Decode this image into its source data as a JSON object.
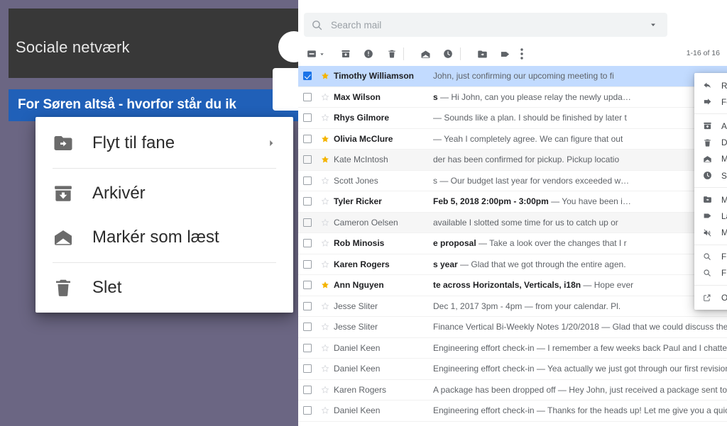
{
  "left_panel": {
    "background_color": "#6b6683",
    "topbar": {
      "background_color": "#383838",
      "title": "Sociale netværk",
      "fab_name": "compose-fab"
    },
    "banner": {
      "background_color": "#2060b8",
      "text": "For Søren altså - hvorfor står du ik"
    },
    "menu": {
      "items": [
        {
          "icon": "move-to-tab-icon",
          "label": "Flyt til fane",
          "has_submenu": true
        },
        {
          "separator": true
        },
        {
          "icon": "archive-icon",
          "label": "Arkivér",
          "has_submenu": false
        },
        {
          "icon": "mark-as-read-icon",
          "label": "Markér som læst",
          "has_submenu": false
        },
        {
          "separator": true
        },
        {
          "icon": "delete-icon",
          "label": "Slet",
          "has_submenu": false
        }
      ]
    }
  },
  "gmail": {
    "search": {
      "placeholder": "Search mail",
      "value": "",
      "search_icon": "search-icon",
      "dropdown_icon": "chevron-down-icon"
    },
    "toolbar": {
      "buttons": [
        {
          "name": "select-all-checkbox",
          "icon": "checkbox-indeterminate-icon"
        },
        {
          "name": "select-all-dropdown",
          "icon": "chevron-down-icon"
        },
        {
          "name": "archive-button",
          "icon": "archive-icon"
        },
        {
          "name": "report-spam-button",
          "icon": "report-spam-icon"
        },
        {
          "name": "delete-button",
          "icon": "trash-icon"
        },
        {
          "name": "mark-as-read-button",
          "icon": "open-envelope-icon"
        },
        {
          "name": "snooze-button",
          "icon": "clock-icon"
        },
        {
          "name": "move-to-button",
          "icon": "move-to-folder-icon"
        },
        {
          "name": "labels-button",
          "icon": "label-icon"
        },
        {
          "name": "more-options-button",
          "icon": "more-vert-icon"
        }
      ],
      "count_text": "1-16 of 16"
    },
    "rows": [
      {
        "selected": true,
        "starred": true,
        "unread": true,
        "read_bg": false,
        "sender": "Timothy Williamson",
        "subject": "",
        "snippet": "John, just confirming our upcoming meeting to fi"
      },
      {
        "selected": false,
        "starred": false,
        "unread": true,
        "read_bg": false,
        "sender": "Max Wilson",
        "subject": "s",
        "snippet": "— Hi John, can you please relay the newly upda…"
      },
      {
        "selected": false,
        "starred": false,
        "unread": true,
        "read_bg": false,
        "sender": "Rhys Gilmore",
        "subject": "",
        "snippet": "— Sounds like a plan. I should be finished by later t"
      },
      {
        "selected": false,
        "starred": true,
        "unread": true,
        "read_bg": false,
        "sender": "Olivia McClure",
        "subject": "",
        "snippet": "— Yeah I completely agree. We can figure that out "
      },
      {
        "selected": false,
        "starred": true,
        "unread": false,
        "read_bg": true,
        "sender": "Kate McIntosh",
        "subject": "",
        "snippet": "der has been confirmed for pickup. Pickup locatio"
      },
      {
        "selected": false,
        "starred": false,
        "unread": false,
        "read_bg": false,
        "sender": "Scott Jones",
        "subject": "s",
        "snippet": "— Our budget last year for vendors exceeded w…"
      },
      {
        "selected": false,
        "starred": false,
        "unread": true,
        "read_bg": false,
        "sender": "Tyler Ricker",
        "subject": "Feb 5, 2018 2:00pm - 3:00pm",
        "snippet": "— You have been i…"
      },
      {
        "selected": false,
        "starred": false,
        "unread": false,
        "read_bg": true,
        "sender": "Cameron Oelsen",
        "subject": "",
        "snippet": "available I slotted some time for us to catch up or"
      },
      {
        "selected": false,
        "starred": false,
        "unread": true,
        "read_bg": false,
        "sender": "Rob Minosis",
        "subject": "e proposal",
        "snippet": "— Take a look over the changes that I r"
      },
      {
        "selected": false,
        "starred": false,
        "unread": true,
        "read_bg": false,
        "sender": "Karen Rogers",
        "subject": "s year",
        "snippet": "— Glad that we got through the entire agen."
      },
      {
        "selected": false,
        "starred": true,
        "unread": true,
        "read_bg": false,
        "sender": "Ann Nguyen",
        "subject": "te across Horizontals, Verticals, i18n",
        "snippet": "— Hope ever"
      },
      {
        "selected": false,
        "starred": false,
        "unread": false,
        "read_bg": false,
        "sender": "Jesse Sliter",
        "subject": "Dec 1, 2017 3pm - 4pm",
        "snippet": "— from your calendar. Pl."
      },
      {
        "selected": false,
        "starred": false,
        "unread": false,
        "read_bg": false,
        "sender": "Jesse Sliter",
        "subject": "Finance Vertical Bi-Weekly Notes 1/20/2018",
        "snippet": "— Glad that we could discuss the bu…"
      },
      {
        "selected": false,
        "starred": false,
        "unread": false,
        "read_bg": false,
        "sender": "Daniel Keen",
        "subject": "Engineering effort check-in",
        "snippet": "— I remember a few weeks back Paul and I chatted abo"
      },
      {
        "selected": false,
        "starred": false,
        "unread": false,
        "read_bg": false,
        "sender": "Daniel Keen",
        "subject": "Engineering effort check-in",
        "snippet": "— Yea actually we just got through our first revision an"
      },
      {
        "selected": false,
        "starred": false,
        "unread": false,
        "read_bg": false,
        "sender": "Karen Rogers",
        "subject": "A package has been dropped off",
        "snippet": "— Hey John, just received a package sent to you."
      },
      {
        "selected": false,
        "starred": false,
        "unread": false,
        "read_bg": false,
        "sender": "Daniel Keen",
        "subject": "Engineering effort check-in",
        "snippet": "— Thanks for the heads up! Let me give you a quick ove"
      }
    ],
    "context_menu": {
      "items": [
        {
          "icon": "reply-icon",
          "label": "Reply",
          "has_submenu": false
        },
        {
          "icon": "forward-icon",
          "label": "Forward",
          "has_submenu": false
        },
        {
          "separator": true
        },
        {
          "icon": "archive-icon",
          "label": "Archive",
          "has_submenu": false
        },
        {
          "icon": "trash-icon",
          "label": "Delete",
          "has_submenu": false
        },
        {
          "icon": "open-envelope-icon",
          "label": "Mark as unread",
          "has_submenu": false
        },
        {
          "icon": "clock-icon",
          "label": "Snooze",
          "has_submenu": false
        },
        {
          "separator": true
        },
        {
          "icon": "move-to-folder-icon",
          "label": "Move to",
          "has_submenu": true
        },
        {
          "icon": "label-icon",
          "label": "Label as",
          "has_submenu": true
        },
        {
          "icon": "mute-icon",
          "label": "Mute",
          "has_submenu": false
        },
        {
          "separator": true
        },
        {
          "icon": "search-icon",
          "label": "Find emails from Timothy Williamson",
          "has_submenu": false
        },
        {
          "icon": "search-icon",
          "label": "Find emails with this subject",
          "has_submenu": false
        },
        {
          "separator": true
        },
        {
          "icon": "open-in-new-window-icon",
          "label": "Open in new window",
          "has_submenu": false
        }
      ]
    }
  },
  "colors": {
    "selection_blue": "#c2dbff",
    "accent_blue": "#1a73e8",
    "banner_blue": "#2060b8",
    "star_gold": "#f4b400",
    "purple_bg": "#6b6683",
    "dark_bar": "#383838"
  }
}
